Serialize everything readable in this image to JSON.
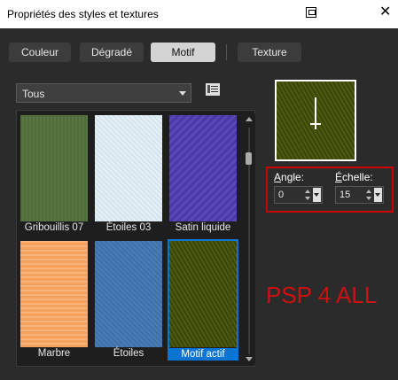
{
  "window": {
    "title": "Propriétés des styles et textures",
    "close_glyph": "✕"
  },
  "tabs": [
    {
      "label": "Couleur",
      "active": false
    },
    {
      "label": "Dégradé",
      "active": false
    },
    {
      "label": "Motif",
      "active": true
    },
    {
      "label": "Texture",
      "active": false
    }
  ],
  "filter": {
    "selected": "Tous",
    "menu_icon": "list-menu-icon"
  },
  "gallery": {
    "items": [
      {
        "label": "Gribouillis 07",
        "color": "#4f6b3a",
        "selected": false
      },
      {
        "label": "Étoiles 03",
        "color": "#e6f0f5",
        "selected": false
      },
      {
        "label": "Satin liquide",
        "color": "#4b39a8",
        "selected": false
      },
      {
        "label": "Marbre",
        "color": "#f5a25e",
        "selected": false
      },
      {
        "label": "Étoiles",
        "color": "#3f6fa8",
        "selected": false
      },
      {
        "label": "Motif actif",
        "color": "#4c5a12",
        "selected": true
      }
    ]
  },
  "preview": {
    "color": "#4c5a12"
  },
  "controls": {
    "angle_label_prefix": "A",
    "angle_label_rest": "ngle:",
    "angle_value": "0",
    "scale_label_prefix": "É",
    "scale_label_rest": "chelle:",
    "scale_value": "15"
  },
  "watermark": "PSP 4 ALL",
  "colors": {
    "accent": "#0a74d4",
    "highlight": "#cc0000",
    "background": "#2b2b2b"
  }
}
